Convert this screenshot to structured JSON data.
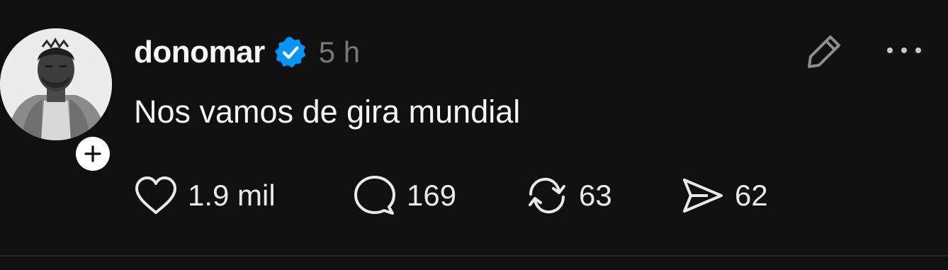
{
  "post": {
    "username": "donomar",
    "verified": true,
    "time_ago": "5 h",
    "text": "Nos vamos de gira mundial",
    "stats": {
      "likes": "1.9 mil",
      "comments": "169",
      "reposts": "63",
      "shares": "62"
    }
  },
  "icons": {
    "follow": "plus-icon",
    "verified": "verified-badge-icon",
    "edit": "pencil-icon",
    "more": "more-dots-icon",
    "like": "heart-icon",
    "comment": "comment-bubble-icon",
    "repost": "repost-icon",
    "share": "send-icon"
  },
  "colors": {
    "background": "#101010",
    "verified": "#0095f6",
    "time": "#777777",
    "text": "#f3f5f7"
  }
}
